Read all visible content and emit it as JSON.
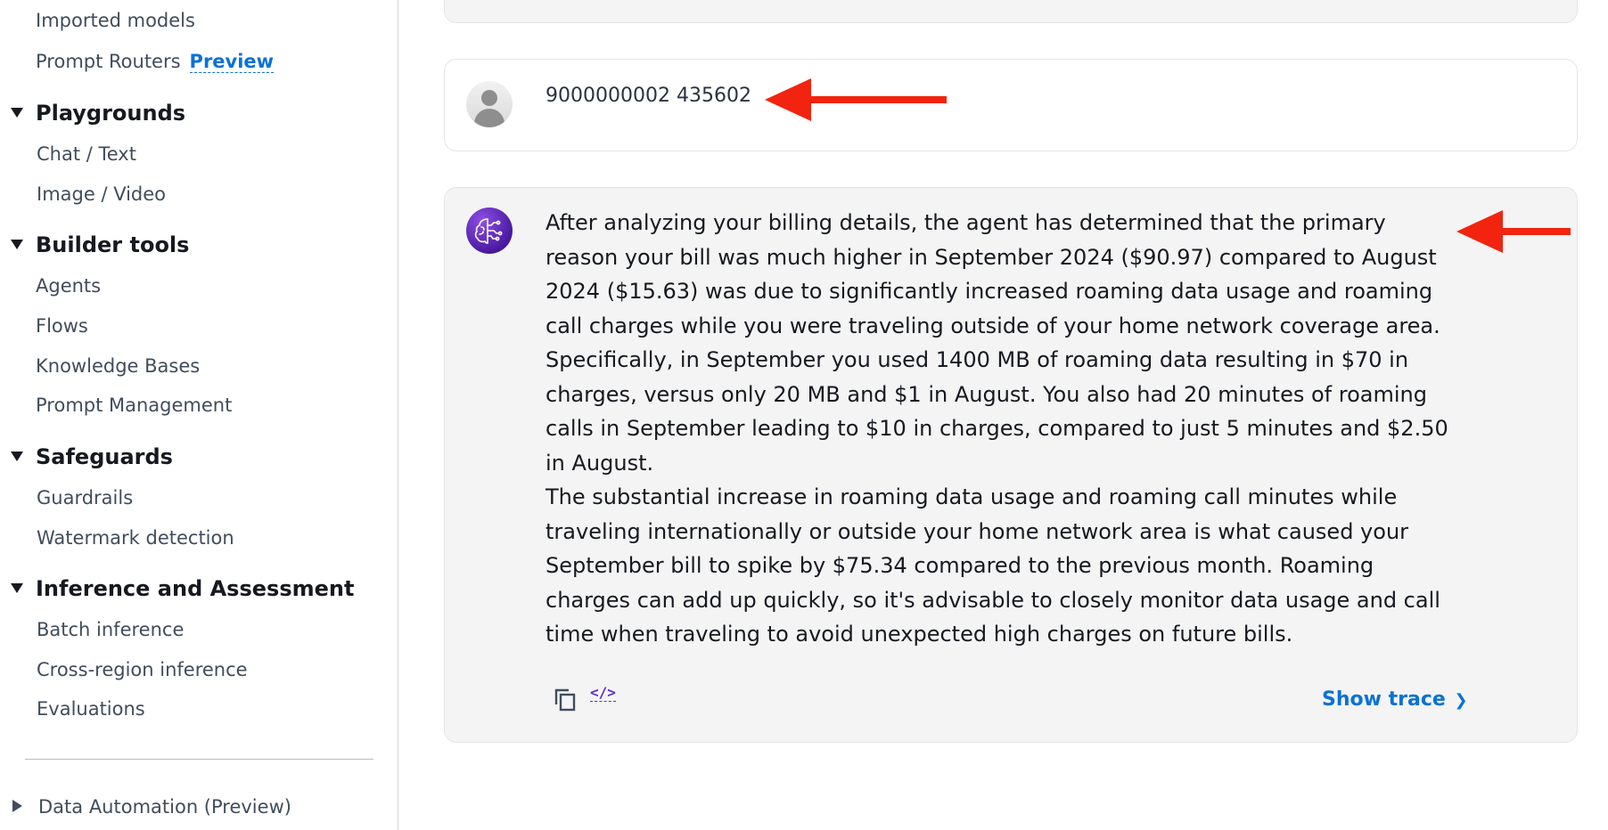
{
  "sidebar": {
    "imported_models": "Imported models",
    "prompt_routers": "Prompt Routers",
    "prompt_routers_badge": "Preview",
    "sections": {
      "playgrounds": {
        "title": "Playgrounds",
        "items": [
          "Chat / Text",
          "Image / Video"
        ]
      },
      "builder_tools": {
        "title": "Builder tools",
        "items": [
          "Agents",
          "Flows",
          "Knowledge Bases",
          "Prompt Management"
        ]
      },
      "safeguards": {
        "title": "Safeguards",
        "items": [
          "Guardrails",
          "Watermark detection"
        ]
      },
      "inference": {
        "title": "Inference and Assessment",
        "items": [
          "Batch inference",
          "Cross-region inference",
          "Evaluations"
        ]
      }
    },
    "data_automation": "Data Automation (Preview)"
  },
  "chat": {
    "user_message": "9000000002 435602",
    "agent_paragraph_1": "After analyzing your billing details, the agent has determined that the primary reason your bill was much higher in September 2024 ($90.97) compared to August 2024 ($15.63) was due to significantly increased roaming data usage and roaming call charges while you were traveling outside of your home network coverage area. Specifically, in September you used 1400 MB of roaming data resulting in $70 in charges, versus only 20 MB and $1 in August. You also had 20 minutes of roaming calls in September leading to $10 in charges, compared to just 5 minutes and $2.50 in August.",
    "agent_paragraph_2": "The substantial increase in roaming data usage and roaming call minutes while traveling internationally or outside your home network area is what caused your September bill to spike by $75.34 compared to the previous month. Roaming charges can add up quickly, so it's advisable to closely monitor data usage and call time when traveling to avoid unexpected high charges on future bills.",
    "code_icon_label": "</>",
    "show_trace": "Show trace",
    "show_trace_chevron": "❯"
  },
  "colors": {
    "link": "#0972d3",
    "annotation_arrow": "#f2240f",
    "agent_avatar": "#4a1a9e"
  },
  "icons": [
    "triangle-down-icon",
    "triangle-right-icon",
    "user-avatar-icon",
    "ai-brain-icon",
    "copy-icon",
    "code-icon",
    "chevron-right-icon",
    "red-arrow-icon"
  ]
}
